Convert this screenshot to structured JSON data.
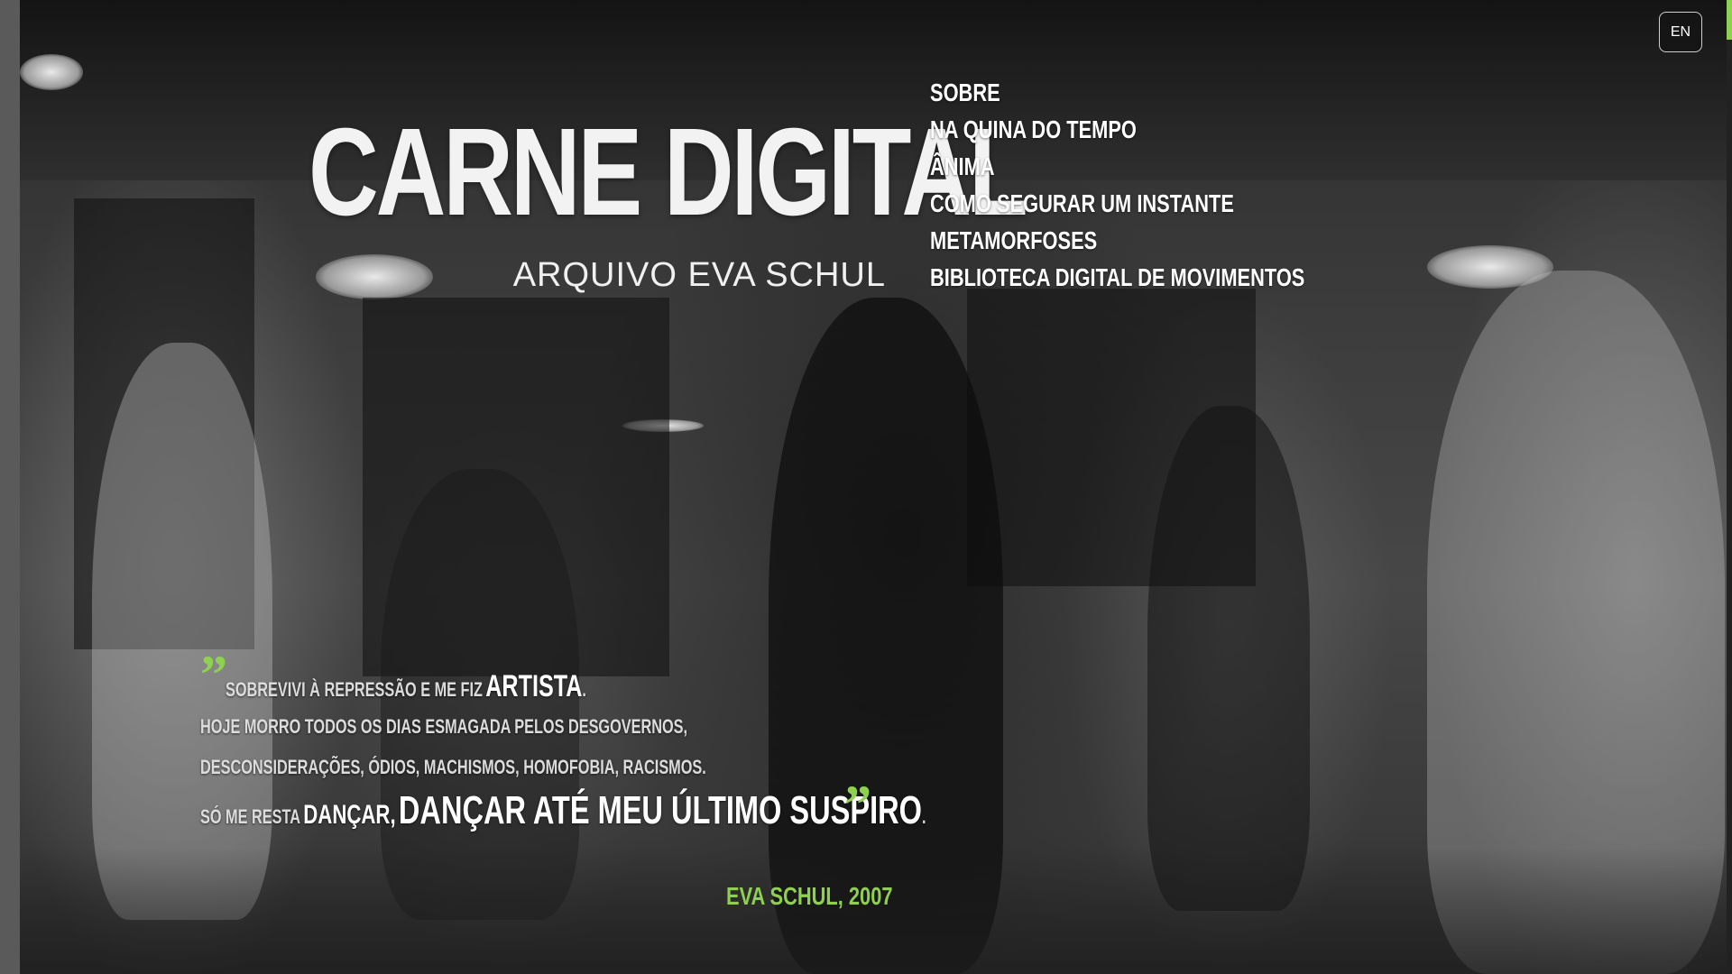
{
  "header": {
    "title": "CARNE DIGITAL",
    "subtitle": "ARQUIVO EVA SCHUL",
    "language_button": "EN"
  },
  "nav": {
    "items": [
      "SOBRE",
      "NA QUINA DO TEMPO",
      "ÂNIMA",
      "COMO SEGURAR UM INSTANTE",
      "METAMORFOSES",
      "BIBLIOTECA DIGITAL DE MOVIMENTOS"
    ]
  },
  "quote": {
    "open_mark": "”",
    "close_mark": "”",
    "line1": {
      "a": "Sobrevivi à repressão e me fiz",
      "b": "Artista",
      "c": "."
    },
    "line2": "Hoje morro todos os dias esmagada pelos desgovernos,",
    "line3": "desconsiderações, ódios, machismos, homofobia, racismos.",
    "line4": {
      "a": "Só me resta",
      "b": "dançar,",
      "c": "dançar até meu último suspiro",
      "d": "."
    },
    "author": "EVA SCHUL, 2007"
  },
  "colors": {
    "accent": "#8fd14f",
    "text": "#ffffff",
    "background": "#3a3a3a"
  }
}
